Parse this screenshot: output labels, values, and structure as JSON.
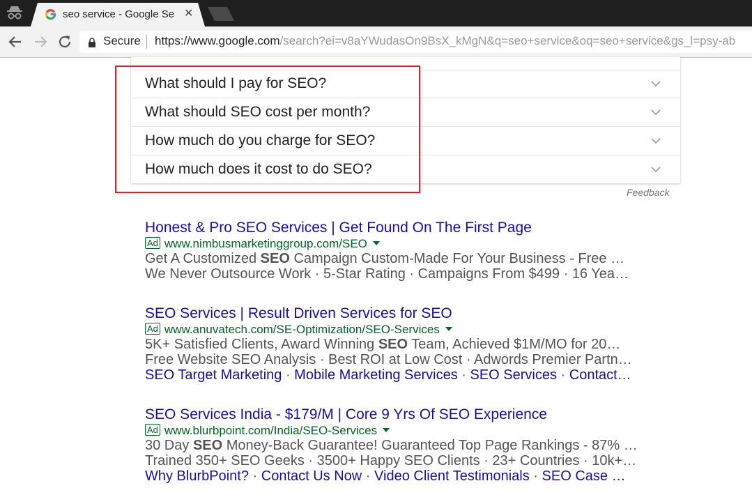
{
  "browser": {
    "tab_title": "seo service - Google Sear",
    "secure_label": "Secure",
    "url_host": "https://www.google.com",
    "url_rest": "/search?ei=v8aYWudasOn9BsX_kMgN&q=seo+service&oq=seo+service&gs_l=psy-ab"
  },
  "people_also_ask": {
    "questions": [
      "What should I pay for SEO?",
      "What should SEO cost per month?",
      "How much do you charge for SEO?",
      "How much does it cost to do SEO?"
    ],
    "feedback": "Feedback"
  },
  "ads": [
    {
      "title": "Honest & Pro SEO Services | Get Found On The First Page",
      "badge": "Ad",
      "url": "www.nimbusmarketinggroup.com/SEO",
      "desc1_pre": "Get A Customized ",
      "desc1_bold": "SEO",
      "desc1_post": " Campaign Custom-Made For Your Business - Free …",
      "desc2": "We Never Outsource Work · 5-Star Rating · Campaigns From $499 · 16 Yea…"
    },
    {
      "title": "SEO Services | Result Driven Services for SEO",
      "badge": "Ad",
      "url": "www.anuvatech.com/SE-Optimization/SEO-Services",
      "desc1_pre": "5K+ Satisfied Clients, Award Winning ",
      "desc1_bold": "SEO",
      "desc1_post": " Team, Achieved $1M/MO for 20…",
      "desc2": "Free Website SEO Analysis · Best ROI at Low Cost · Adwords Premier Partn…",
      "sitelinks": [
        "SEO Target Marketing",
        "Mobile Marketing Services",
        "SEO Services",
        "Contact…"
      ]
    },
    {
      "title": "SEO Services India - $179/M | Core 9 Yrs Of SEO Experience",
      "badge": "Ad",
      "url": "www.blurbpoint.com/India/SEO-Services",
      "desc1_pre": "30 Day ",
      "desc1_bold": "SEO",
      "desc1_post": " Money-Back Guarantee! Guaranteed Top Page Rankings - 87% …",
      "desc2": "Trained 350+ SEO Geeks · 3500+ Happy SEO Clients · 23+ Countries · 10k+…",
      "sitelinks": [
        "Why BlurbPoint?",
        "Contact Us Now",
        "Video Client Testimonials",
        "SEO Case …"
      ]
    }
  ],
  "colors": {
    "link": "#1a0dab",
    "url_green": "#006621",
    "highlight": "#e01f1f"
  }
}
